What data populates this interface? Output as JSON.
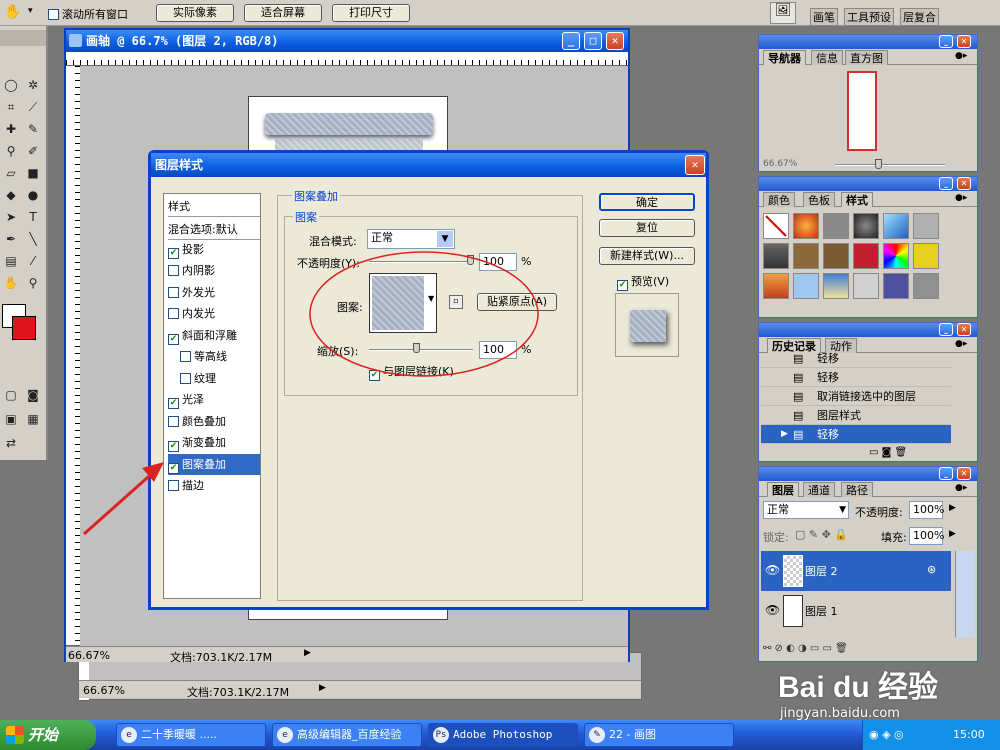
{
  "options_bar": {
    "scroll_all_label": "滚动所有窗口",
    "actual_pixels_label": "实际像素",
    "fit_screen_label": "适合屏幕",
    "print_size_label": "打印尺寸",
    "tabs": [
      "画笔",
      "工具预设",
      "层复合"
    ]
  },
  "document": {
    "title": "画轴 @ 66.7% (图层 2, RGB/8)",
    "zoom": "66.67%",
    "doc_size": "文档:703.1K/2.17M"
  },
  "document_back": {
    "zoom": "66.67%",
    "doc_size": "文档:703.1K/2.17M"
  },
  "navigator": {
    "tabs": [
      "导航器",
      "信息",
      "直方图"
    ],
    "zoom": "66.67%"
  },
  "styles_panel": {
    "tabs": [
      "颜色",
      "色板",
      "样式"
    ]
  },
  "history": {
    "tabs": [
      "历史记录",
      "动作"
    ],
    "items": [
      {
        "label": "轻移"
      },
      {
        "label": "轻移"
      },
      {
        "label": "取消链接选中的图层"
      },
      {
        "label": "图层样式"
      },
      {
        "label": "轻移"
      }
    ]
  },
  "layers": {
    "tabs": [
      "图层",
      "通道",
      "路径"
    ],
    "blend_mode": "正常",
    "opacity_label": "不透明度:",
    "opacity_value": "100%",
    "lock_label": "锁定:",
    "fill_label": "填充:",
    "fill_value": "100%",
    "items": [
      {
        "name": "图层 2"
      },
      {
        "name": "图层 1"
      }
    ]
  },
  "dialog": {
    "title": "图层样式",
    "sidebar": [
      {
        "label": "样式",
        "checkbox": false,
        "checked": false
      },
      {
        "label": "混合选项:默认",
        "checkbox": false,
        "checked": false
      },
      {
        "label": "投影",
        "checkbox": true,
        "checked": true
      },
      {
        "label": "内阴影",
        "checkbox": true,
        "checked": false
      },
      {
        "label": "外发光",
        "checkbox": true,
        "checked": false
      },
      {
        "label": "内发光",
        "checkbox": true,
        "checked": false
      },
      {
        "label": "斜面和浮雕",
        "checkbox": true,
        "checked": true
      },
      {
        "label": "等高线",
        "checkbox": true,
        "checked": false
      },
      {
        "label": "纹理",
        "checkbox": true,
        "checked": false
      },
      {
        "label": "光泽",
        "checkbox": true,
        "checked": true
      },
      {
        "label": "颜色叠加",
        "checkbox": true,
        "checked": false
      },
      {
        "label": "渐变叠加",
        "checkbox": true,
        "checked": true
      },
      {
        "label": "图案叠加",
        "checkbox": true,
        "checked": true
      },
      {
        "label": "描边",
        "checkbox": true,
        "checked": false
      }
    ],
    "group_title": "图案叠加",
    "sub_group_title": "图案",
    "blend_mode_label": "混合模式:",
    "blend_mode_value": "正常",
    "opacity_label": "不透明度(Y):",
    "opacity_value": "100",
    "percent": "%",
    "pattern_label": "图案:",
    "snap_origin_label": "贴紧原点(A)",
    "scale_label": "缩放(S):",
    "scale_value": "100",
    "link_label": "与图层链接(K)",
    "ok_label": "确定",
    "reset_label": "复位",
    "new_style_label": "新建样式(W)...",
    "preview_label": "预览(V)"
  },
  "taskbar": {
    "start_label": "开始",
    "tasks": [
      "二十季暖暖 .....",
      "高级编辑器_百度经验",
      "Adobe Photoshop",
      "22 - 画图"
    ],
    "clock": "15:00"
  },
  "watermark": {
    "text": "Bai du 经验",
    "url": "jingyan.baidu.com"
  },
  "colors": {
    "xp_blue": "#0a5ee0",
    "highlight": "#2a63c2",
    "annotation_red": "#d9231f"
  }
}
